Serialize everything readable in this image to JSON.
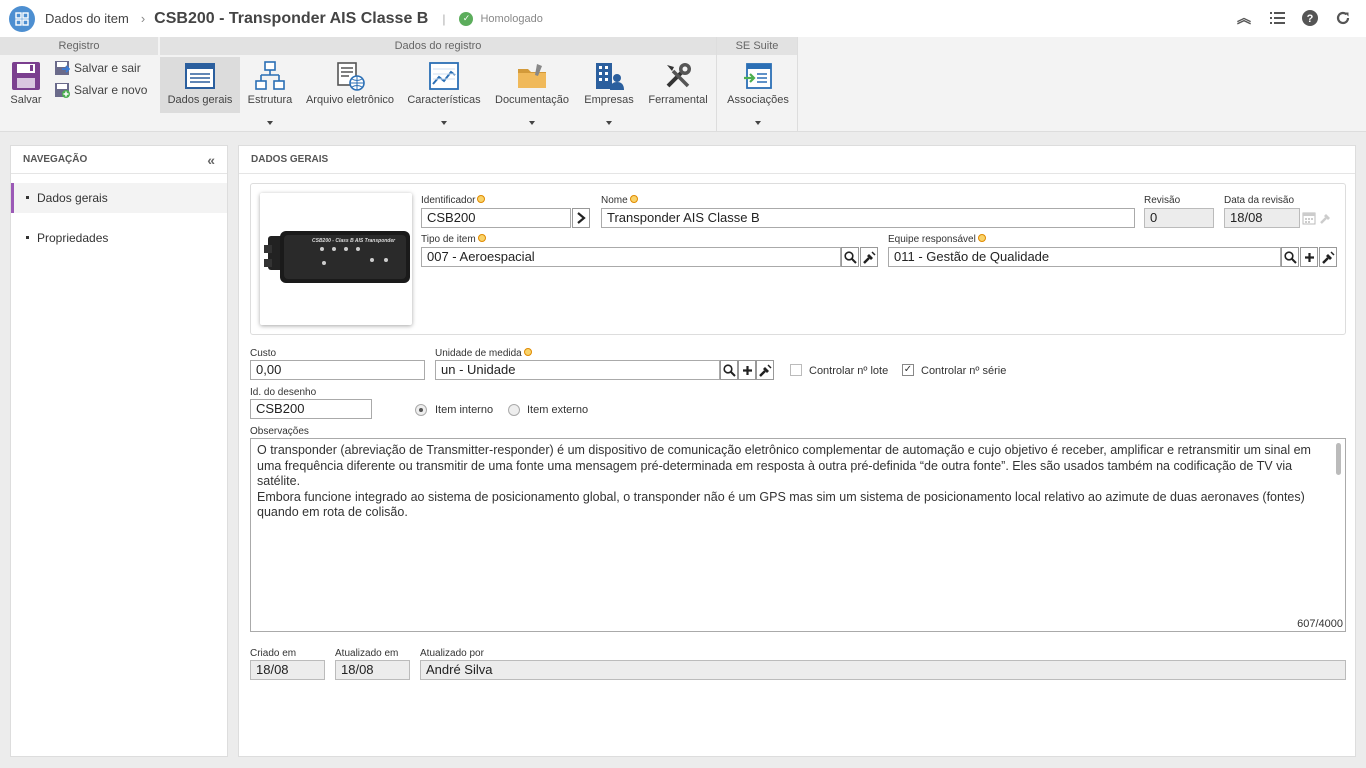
{
  "header": {
    "breadcrumb": "Dados do item",
    "breadcrumb_sep": "›",
    "title": "CSB200 - Transponder AIS Classe B",
    "title_divider": "|",
    "status": "Homologado"
  },
  "ribbon": {
    "groups": {
      "registro": "Registro",
      "dados_registro": "Dados do registro",
      "se_suite": "SE Suite"
    },
    "salvar": "Salvar",
    "salvar_sair": "Salvar e sair",
    "salvar_novo": "Salvar e novo",
    "dados_gerais": "Dados gerais",
    "estrutura": "Estrutura",
    "arquivo": "Arquivo eletrônico",
    "caracteristicas": "Características",
    "documentacao": "Documentação",
    "empresas": "Empresas",
    "ferramental": "Ferramental",
    "associacoes": "Associações"
  },
  "nav": {
    "title": "NAVEGAÇÃO",
    "collapse": "«",
    "items": [
      "Dados gerais",
      "Propriedades"
    ]
  },
  "main": {
    "title": "DADOS GERAIS",
    "photo_text": "CSB200 - Class B AIS Transponder",
    "identificador": {
      "label": "Identificador",
      "value": "CSB200"
    },
    "nome": {
      "label": "Nome",
      "value": "Transponder AIS Classe B"
    },
    "revisao": {
      "label": "Revisão",
      "value": "0"
    },
    "data_revisao": {
      "label": "Data da revisão",
      "value": "18/08"
    },
    "tipo_item": {
      "label": "Tipo de item",
      "value": "007 - Aeroespacial"
    },
    "equipe": {
      "label": "Equipe responsável",
      "value": "011 - Gestão de Qualidade"
    },
    "custo": {
      "label": "Custo",
      "value": "0,00"
    },
    "unidade": {
      "label": "Unidade de medida",
      "value": "un - Unidade"
    },
    "controlar_lote": {
      "label": "Controlar nº lote",
      "checked": false
    },
    "controlar_serie": {
      "label": "Controlar nº série",
      "checked": true
    },
    "id_desenho": {
      "label": "Id. do desenho",
      "value": "CSB200"
    },
    "item_interno": {
      "label": "Item interno",
      "selected": true
    },
    "item_externo": {
      "label": "Item externo",
      "selected": false
    },
    "observacoes": {
      "label": "Observações",
      "para1": "O transponder (abreviação de Transmitter-responder) é um dispositivo de comunicação eletrônico complementar de automação e cujo objetivo é receber, amplificar e retransmitir um sinal em uma frequência diferente ou transmitir de uma fonte uma mensagem pré-determinada em resposta à outra pré-definida “de outra fonte”. Eles são usados também na codificação de TV via satélite.",
      "para2": "Embora funcione integrado ao sistema de posicionamento global, o transponder não é um GPS mas sim um sistema de posicionamento local relativo ao azimute de duas aeronaves (fontes) quando em rota de colisão.",
      "counter": "607/4000"
    },
    "criado_em": {
      "label": "Criado em",
      "value": "18/08"
    },
    "atualizado_em": {
      "label": "Atualizado em",
      "value": "18/08"
    },
    "atualizado_por": {
      "label": "Atualizado por",
      "value": "André Silva"
    }
  },
  "colors": {
    "accent": "#9b59b6",
    "brand": "#4d8fd1",
    "status_ok": "#5cad5c"
  }
}
